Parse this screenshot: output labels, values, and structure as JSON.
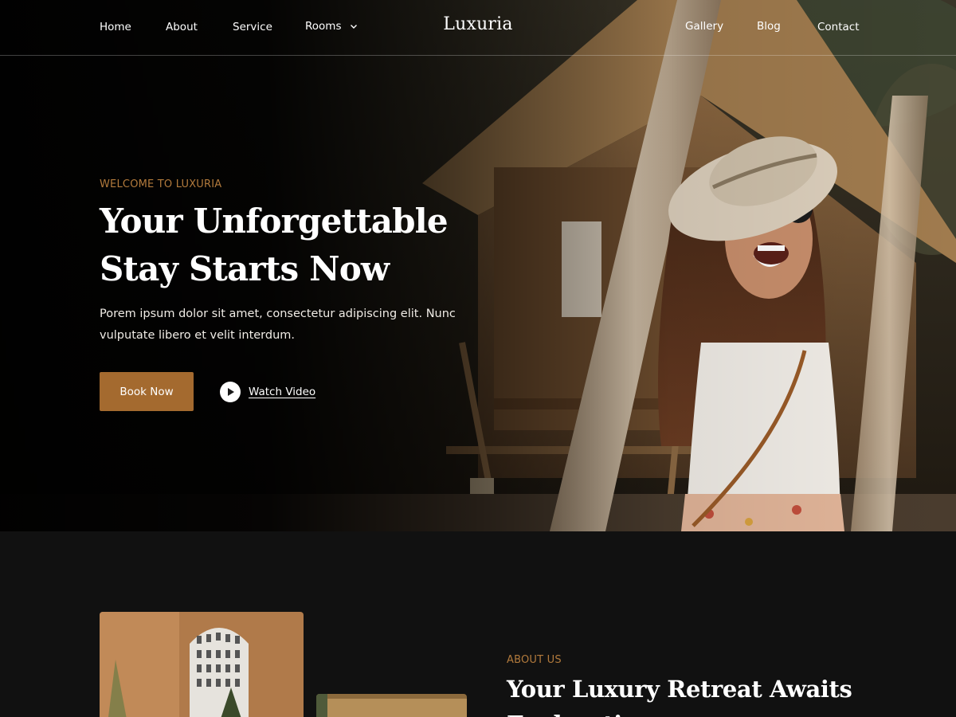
{
  "nav": {
    "left_links": [
      "Home",
      "About",
      "Service",
      "Rooms"
    ],
    "brand": "Luxuria",
    "right_links": [
      "Gallery",
      "Blog",
      "Contact"
    ]
  },
  "hero": {
    "eyebrow": "WELCOME TO LUXURIA",
    "title": "Your Unforgettable Stay Starts Now",
    "description": "Porem ipsum dolor sit amet, consectetur adipiscing elit. Nunc vulputate libero et velit interdum.",
    "book_button": "Book Now",
    "watch_video": "Watch Video"
  },
  "about": {
    "eyebrow": "ABOUT US",
    "title": "Your Luxury Retreat Awaits Exploration"
  },
  "colors": {
    "accent": "#a46a2f",
    "accent_text": "#b27a3c",
    "background": "#111111"
  },
  "icons": {
    "rooms_dropdown": "chevron-down-icon",
    "watch_video": "play-icon"
  }
}
